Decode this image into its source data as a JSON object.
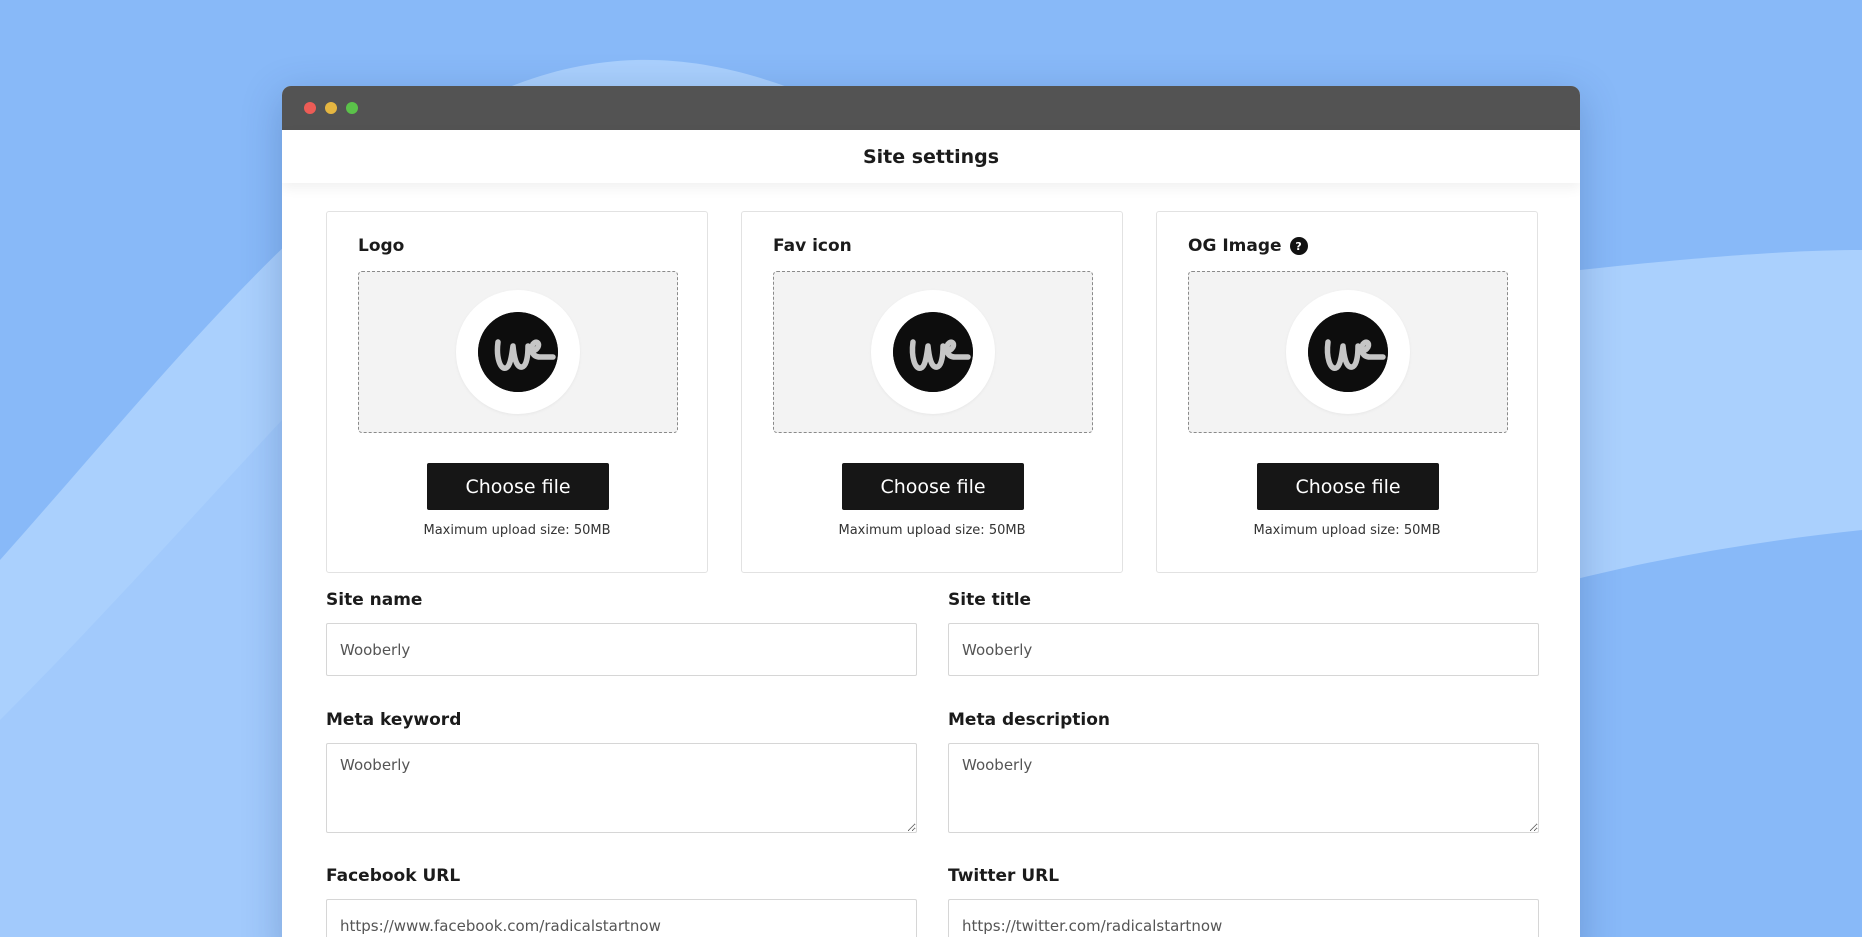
{
  "page": {
    "title": "Site settings"
  },
  "uploads": [
    {
      "label": "Logo",
      "button": "Choose file",
      "note": "Maximum upload size: 50MB"
    },
    {
      "label": "Fav icon",
      "button": "Choose file",
      "note": "Maximum upload size: 50MB"
    },
    {
      "label": "OG Image",
      "button": "Choose file",
      "note": "Maximum upload size: 50MB",
      "help": "?"
    }
  ],
  "fields": {
    "site_name": {
      "label": "Site name",
      "value": "Wooberly"
    },
    "site_title": {
      "label": "Site title",
      "value": "Wooberly"
    },
    "meta_keyword": {
      "label": "Meta keyword",
      "value": "Wooberly"
    },
    "meta_description": {
      "label": "Meta description",
      "value": "Wooberly"
    },
    "facebook_url": {
      "label": "Facebook URL",
      "value": "https://www.facebook.com/radicalstartnow"
    },
    "twitter_url": {
      "label": "Twitter URL",
      "value": "https://twitter.com/radicalstartnow"
    }
  },
  "icons": {
    "window_controls": [
      "close-dot",
      "minimize-dot",
      "maximize-dot"
    ],
    "help": "question-circle-icon",
    "logo": "wooberly-logo-icon"
  },
  "colors": {
    "background": "#88b9f8",
    "background_light": "#aad0fd",
    "titlebar": "#535353",
    "button": "#161616",
    "dropzone": "#f3f3f3"
  }
}
